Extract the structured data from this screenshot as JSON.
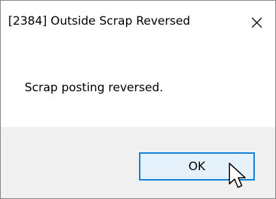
{
  "dialog": {
    "title": "[2384] Outside Scrap Reversed",
    "close_icon": "close-icon",
    "message": "Scrap posting reversed.",
    "ok_label": "OK"
  },
  "colors": {
    "footer_bg": "#f0f0f0",
    "button_bg": "#e5f1fb",
    "button_border": "#0078d7"
  },
  "cursor_icon": "mouse-pointer-icon"
}
